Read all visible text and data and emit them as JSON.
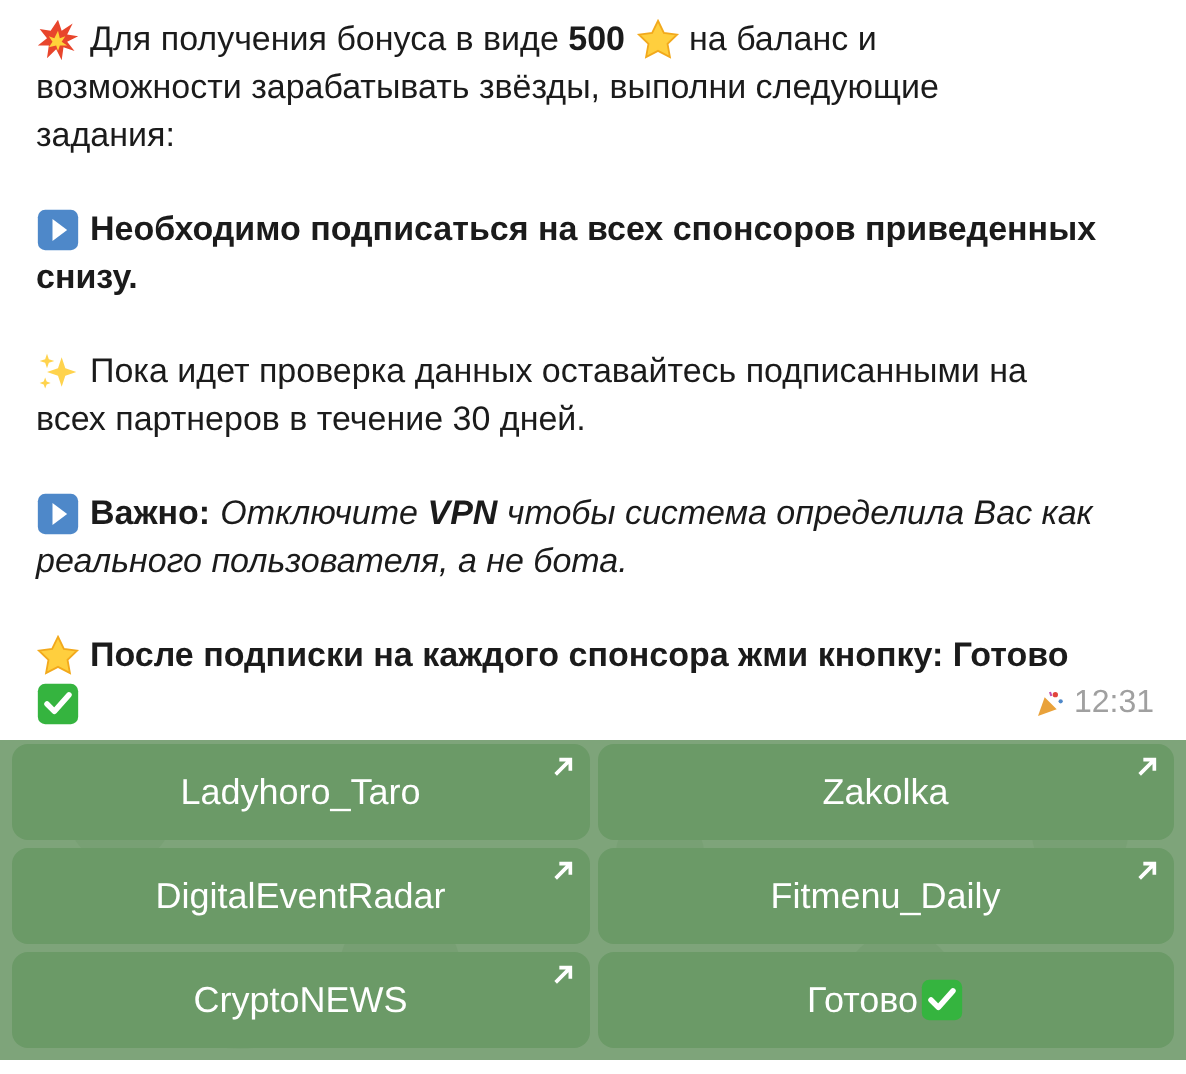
{
  "message": {
    "paragraphs": [
      {
        "lines": [
          [
            {
              "kind": "boom"
            },
            {
              "kind": "text",
              "text": "Для получения бонуса в виде **500**"
            },
            {
              "kind": "star"
            },
            {
              "kind": "text",
              "text": "на баланс и"
            }
          ],
          [
            {
              "kind": "text",
              "text": "возможности зарабатывать звёзды, выполни следующие"
            }
          ],
          [
            {
              "kind": "text",
              "text": "задания:"
            }
          ]
        ]
      },
      {
        "lines": [
          [
            {
              "kind": "play"
            },
            {
              "kind": "strong",
              "text": "Необходимо подписаться на всех спонсоров приведенных"
            }
          ],
          [
            {
              "kind": "strong",
              "text": "снизу."
            }
          ]
        ]
      },
      {
        "lines": [
          [
            {
              "kind": "sparkles"
            },
            {
              "kind": "text",
              "text": "Пока идет проверка данных оставайтесь подписанными на"
            }
          ],
          [
            {
              "kind": "text",
              "text": "всех партнеров в течение 30 дней."
            }
          ]
        ]
      },
      {
        "lines": [
          [
            {
              "kind": "play"
            },
            {
              "kind": "strong",
              "text": "Важно:"
            },
            {
              "kind": "italic",
              "text": "Отключите **VPN** чтобы система определила Вас как"
            }
          ],
          [
            {
              "kind": "italic",
              "text": "реального пользователя, а не бота."
            }
          ]
        ]
      },
      {
        "lines": [
          [
            {
              "kind": "star"
            },
            {
              "kind": "strong",
              "text": "После подписки на каждого спонсора жми кнопку: Готово"
            }
          ],
          [
            {
              "kind": "check"
            }
          ]
        ]
      }
    ],
    "time": "12:31"
  },
  "buttons": [
    {
      "label": "Ladyhoro_Taro",
      "kind": "url"
    },
    {
      "label": "Zakolka",
      "kind": "url"
    },
    {
      "label": "DigitalEventRadar",
      "kind": "url"
    },
    {
      "label": "Fitmenu_Daily",
      "kind": "url"
    },
    {
      "label": "CryptoNEWS",
      "kind": "url"
    },
    {
      "label": "Готово",
      "kind": "check"
    }
  ]
}
